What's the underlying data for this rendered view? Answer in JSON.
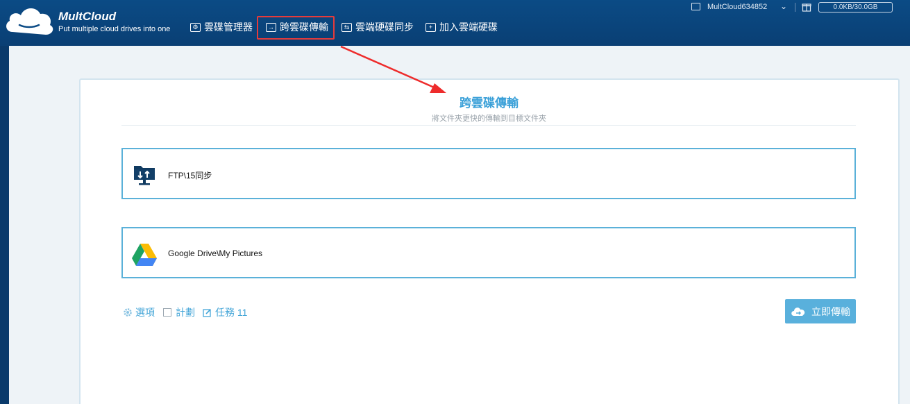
{
  "brand": {
    "name": "MultCloud",
    "slogan": "Put multiple cloud drives into one"
  },
  "nav": [
    {
      "label": "雲碟管理器",
      "icon": "gear-box-icon"
    },
    {
      "label": "跨雲碟傳輸",
      "icon": "transfer-box-icon",
      "active": true
    },
    {
      "label": "雲端硬碟同步",
      "icon": "sync-box-icon"
    },
    {
      "label": "加入雲端硬碟",
      "icon": "plus-box-icon"
    }
  ],
  "user": {
    "name": "MultCloud634852",
    "quota": "0.0KB/30.0GB"
  },
  "page": {
    "title": "跨雲碟傳輸",
    "subtitle": "將文件夾更快的傳輸到目標文件夾"
  },
  "source": {
    "path": "FTP\\15同步",
    "icon": "ftp-folder-icon"
  },
  "target": {
    "path": "Google Drive\\My Pictures",
    "icon": "google-drive-icon"
  },
  "options": {
    "settings": "選項",
    "schedule": "計劃",
    "task": "任務 11"
  },
  "actions": {
    "transfer_now": "立即傳輸"
  },
  "colors": {
    "accent": "#3aa0d8",
    "header": "#0b4b85",
    "highlight": "#e53b3b",
    "button": "#59b0dc"
  }
}
